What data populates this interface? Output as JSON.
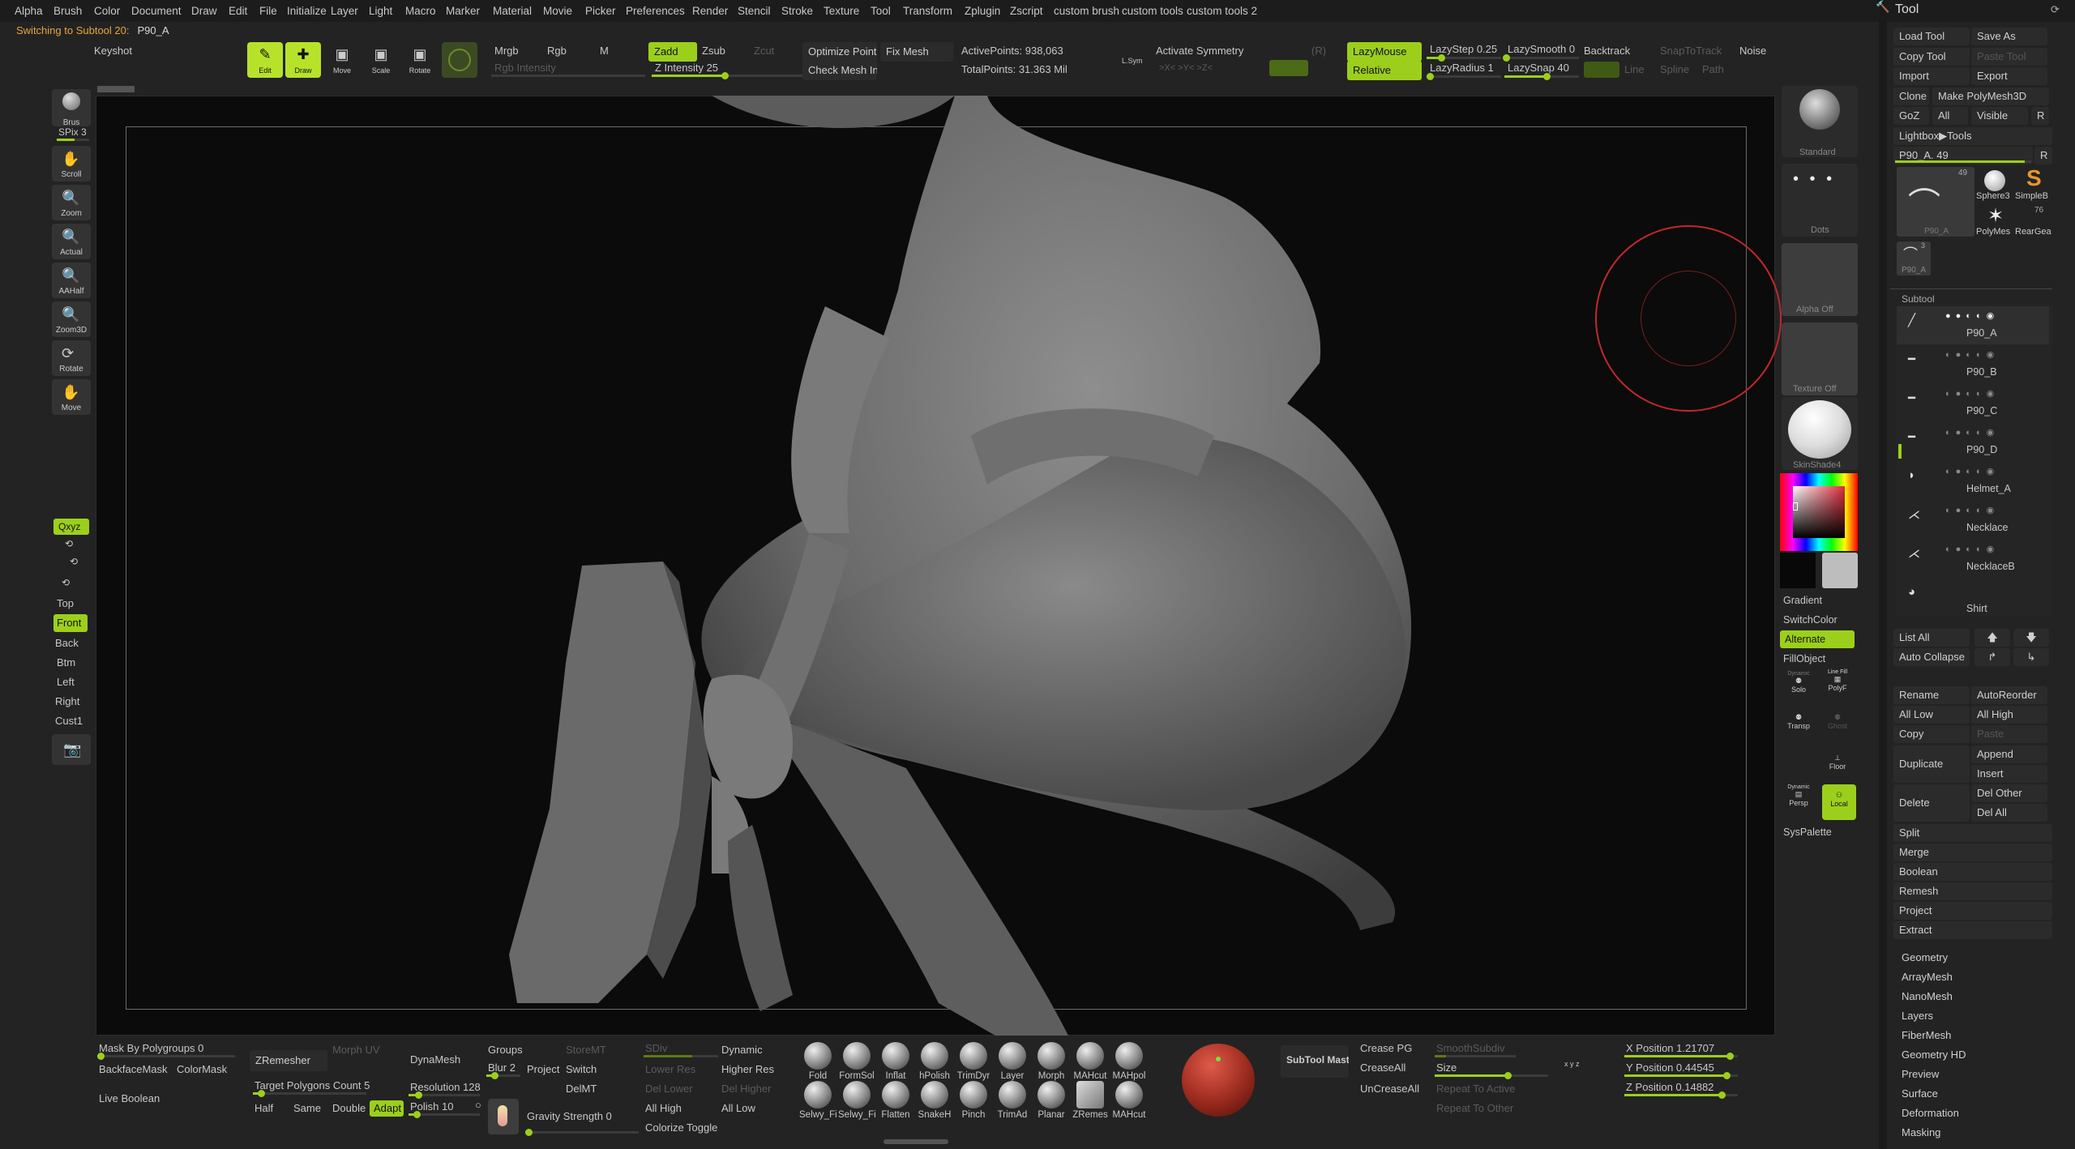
{
  "menu": [
    "Alpha",
    "Brush",
    "Color",
    "Document",
    "Draw",
    "Edit",
    "File",
    "Initialize",
    "Layer",
    "Light",
    "Macro",
    "Marker",
    "Material",
    "Movie",
    "Picker",
    "Preferences",
    "Render",
    "Stencil",
    "Stroke",
    "Texture",
    "Tool",
    "Transform",
    "Zplugin",
    "Zscript",
    "custom brush",
    "custom tools",
    "custom tools 2"
  ],
  "status": {
    "message": "Switching to Subtool 20:",
    "subtool": "P90_A"
  },
  "top": {
    "keyshot": "Keyshot",
    "modes": [
      "Edit",
      "Draw",
      "Move",
      "Scale",
      "Rotate"
    ],
    "mrgb": "Mrgb",
    "rgb": "Rgb",
    "m": "M",
    "rgb_intensity": "Rgb Intensity",
    "zadd": "Zadd",
    "zsub": "Zsub",
    "zcut": "Zcut",
    "z_intensity": "Z Intensity 25",
    "optimize": "Optimize Points",
    "fix_mesh": "Fix Mesh",
    "check_mesh": "Check Mesh Inte",
    "active_points": "ActivePoints: 938,063",
    "total_points": "TotalPoints: 31.363 Mil",
    "lsym": "L.Sym",
    "xyz": ">X<  >Y<  >Z<",
    "activate_symmetry": "Activate Symmetry",
    "r": "(R)",
    "lazymouse": "LazyMouse",
    "relative": "Relative",
    "lazystep": "LazyStep 0.25",
    "lazyradius": "LazyRadius 1",
    "lazysmooth": "LazySmooth 0",
    "lazysnap": "LazySnap 40",
    "backtrack": "Backtrack",
    "line": "Line",
    "spline": "Spline",
    "path": "Path",
    "snaptotrack": "SnapToTrack",
    "noise": "Noise"
  },
  "left_shelf": [
    {
      "label": "Brus",
      "icon": "sphere-icon"
    },
    {
      "label": "Scroll",
      "icon": "hand-icon"
    },
    {
      "label": "Zoom",
      "icon": "zoom-icon"
    },
    {
      "label": "Actual",
      "icon": "zoom-icon"
    },
    {
      "label": "AAHalf",
      "icon": "zoom-icon"
    },
    {
      "label": "Zoom3D",
      "icon": "zoom-icon"
    },
    {
      "label": "Rotate",
      "icon": "rotate-icon"
    },
    {
      "label": "Move",
      "icon": "hand-icon"
    }
  ],
  "spix": "SPix 3",
  "views": {
    "xyz": "Qxyz",
    "top": "Top",
    "front": "Front",
    "back": "Back",
    "btm": "Btm",
    "left": "Left",
    "right": "Right",
    "cust1": "Cust1"
  },
  "right_shelf": {
    "standard": "Standard",
    "dots": "Dots",
    "alpha_off": "Alpha Off",
    "texture_off": "Texture Off",
    "material": "SkinShade4",
    "gradient": "Gradient",
    "switch_color": "SwitchColor",
    "alternate": "Alternate",
    "fill_object": "FillObject",
    "solo": "Solo",
    "polyf": "PolyF",
    "transp": "Transp",
    "ghost": "Ghost",
    "floor": "Floor",
    "persp": "Persp",
    "local": "Local",
    "dynamic": "Dynamic",
    "line_fill": "Line Fill",
    "syspalette": "SysPalette"
  },
  "tool": {
    "title": "Tool",
    "load_tool": "Load Tool",
    "save_as": "Save As",
    "copy_tool": "Copy Tool",
    "paste_tool": "Paste Tool",
    "import": "Import",
    "export": "Export",
    "clone": "Clone",
    "make_polymesh": "Make PolyMesh3D",
    "goz": "GoZ",
    "all": "All",
    "visible": "Visible",
    "r": "R",
    "lightbox": "Lightbox▶Tools",
    "current": "P90_A. 49",
    "r2": "R",
    "thumbs": [
      {
        "label": "P90_A",
        "count": "49"
      },
      {
        "label": "Sphere3"
      },
      {
        "label": "SimpleB"
      },
      {
        "label": "PolyMes"
      },
      {
        "label": "RearGea",
        "count": "76"
      },
      {
        "label": "P90_A",
        "count": "3"
      }
    ],
    "subtool_header": "Subtool",
    "subtools": [
      "P90_A",
      "P90_B",
      "P90_C",
      "P90_D",
      "Helmet_A",
      "Necklace",
      "NecklaceB",
      "Shirt"
    ],
    "list_all": "List All",
    "auto_collapse": "Auto Collapse",
    "rename": "Rename",
    "auto_reorder": "AutoReorder",
    "all_low": "All Low",
    "all_high": "All High",
    "copy": "Copy",
    "paste": "Paste",
    "duplicate": "Duplicate",
    "append": "Append",
    "insert": "Insert",
    "delete": "Delete",
    "del_other": "Del Other",
    "del_all": "Del All",
    "split": "Split",
    "merge": "Merge",
    "boolean": "Boolean",
    "remesh": "Remesh",
    "project": "Project",
    "extract": "Extract",
    "sections": [
      "Geometry",
      "ArrayMesh",
      "NanoMesh",
      "Layers",
      "FiberMesh",
      "Geometry HD",
      "Preview",
      "Surface",
      "Deformation",
      "Masking"
    ]
  },
  "bottom": {
    "mask_by_polygroups": "Mask By Polygroups 0",
    "backface_mask": "BackfaceMask",
    "color_mask": "ColorMask",
    "live_boolean": "Live Boolean",
    "zremesher": "ZRemesher",
    "morph_uv": "Morph UV",
    "target_polygons": "Target Polygons Count 5",
    "half": "Half",
    "same": "Same",
    "double": "Double",
    "adapt": "Adapt",
    "dynamesh": "DynaMesh",
    "resolution": "Resolution 128",
    "polish": "Polish 10",
    "groups": "Groups",
    "blur": "Blur 2",
    "project": "Project",
    "switch": "Switch",
    "storemt": "StoreMT",
    "delmt": "DelMT",
    "gravity": "Gravity Strength 0",
    "sdiv": "SDiv",
    "lower_res": "Lower Res",
    "higher_res": "Higher Res",
    "del_lower": "Del Lower",
    "del_higher": "Del Higher",
    "all_high": "All High",
    "all_low": "All Low",
    "dynamic": "Dynamic",
    "colorize": "Colorize Toggle",
    "brushes_row1": [
      "Fold",
      "FormSol",
      "Inflat",
      "hPolish",
      "TrimDyr",
      "Layer",
      "Morph",
      "MAHcut",
      "MAHpol"
    ],
    "brushes_row2": [
      "Selwy_Fi",
      "Selwy_Fi",
      "Flatten",
      "SnakeH",
      "Pinch",
      "TrimAd",
      "Planar",
      "ZRemes",
      "MAHcut"
    ],
    "subtool_master": "SubTool Master",
    "crease_pg": "Crease PG",
    "crease_all": "CreaseAll",
    "uncrease_all": "UnCreaseAll",
    "smooth_subdiv": "SmoothSubdiv",
    "size": "Size",
    "repeat_active": "Repeat To Active",
    "repeat_other": "Repeat To Other",
    "x_position": "X Position 1.21707",
    "y_position": "Y Position 0.44545",
    "z_position": "Z Position 0.14882"
  },
  "colors": {
    "accent": "#9ccf1c",
    "status": "#e9a43a",
    "cursor": "#c0282b"
  }
}
